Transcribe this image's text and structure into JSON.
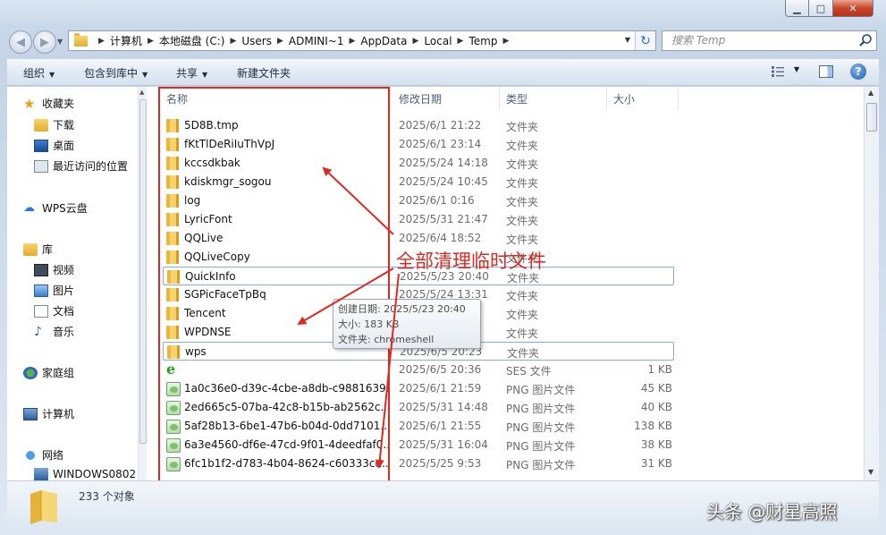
{
  "window": {
    "minimize_glyph": "▁",
    "maximize_glyph": "□",
    "close_glyph": "✕"
  },
  "nav": {
    "back_glyph": "◀",
    "forward_glyph": "▶"
  },
  "address": {
    "crumbs": [
      "计算机",
      "本地磁盘 (C:)",
      "Users",
      "ADMINI~1",
      "AppData",
      "Local",
      "Temp"
    ]
  },
  "search": {
    "placeholder": "搜索 Temp"
  },
  "toolbar": {
    "organize": "组织",
    "include_library": "包含到库中",
    "share": "共享",
    "new_folder": "新建文件夹"
  },
  "sidebar": {
    "favorites": "收藏夹",
    "downloads": "下载",
    "desktop": "桌面",
    "recent": "最近访问的位置",
    "wps_cloud": "WPS云盘",
    "libraries": "库",
    "videos": "视频",
    "pictures": "图片",
    "documents": "文档",
    "music": "音乐",
    "homegroup": "家庭组",
    "computer": "计算机",
    "network": "网络",
    "network_pc": "WINDOWS0802"
  },
  "columns": {
    "name": "名称",
    "date": "修改日期",
    "type": "类型",
    "size": "大小"
  },
  "files": [
    {
      "name": "5D8B.tmp",
      "date": "2025/6/1 21:22",
      "type": "文件夹",
      "size": "",
      "icon": "folder"
    },
    {
      "name": "fKtTlDeRiIuThVpJ",
      "date": "2025/6/1 23:14",
      "type": "文件夹",
      "size": "",
      "icon": "folder"
    },
    {
      "name": "kccsdkbak",
      "date": "2025/5/24 14:18",
      "type": "文件夹",
      "size": "",
      "icon": "folder"
    },
    {
      "name": "kdiskmgr_sogou",
      "date": "2025/5/24 10:45",
      "type": "文件夹",
      "size": "",
      "icon": "folder"
    },
    {
      "name": "log",
      "date": "2025/6/1 0:16",
      "type": "文件夹",
      "size": "",
      "icon": "folder"
    },
    {
      "name": "LyricFont",
      "date": "2025/5/31 21:47",
      "type": "文件夹",
      "size": "",
      "icon": "folder"
    },
    {
      "name": "QQLive",
      "date": "2025/6/4 18:52",
      "type": "文件夹",
      "size": "",
      "icon": "folder"
    },
    {
      "name": "QQLiveCopy",
      "date": "",
      "type": "文件夹",
      "size": "",
      "icon": "folder"
    },
    {
      "name": "QuickInfo",
      "date": "2025/5/23 20:40",
      "type": "文件夹",
      "size": "",
      "icon": "folder"
    },
    {
      "name": "SGPicFaceTpBq",
      "date": "2025/5/24 13:31",
      "type": "文件夹",
      "size": "",
      "icon": "folder"
    },
    {
      "name": "Tencent",
      "date": "",
      "type": "文件夹",
      "size": "",
      "icon": "folder"
    },
    {
      "name": "WPDNSE",
      "date": "",
      "type": "文件夹",
      "size": "",
      "icon": "folder"
    },
    {
      "name": "wps",
      "date": "2025/6/5 20:23",
      "type": "文件夹",
      "size": "",
      "icon": "folder"
    },
    {
      "name": "",
      "date": "2025/6/5 20:36",
      "type": "SES 文件",
      "size": "1 KB",
      "icon": "ie"
    },
    {
      "name": "1a0c36e0-d39c-4cbe-a8db-c9881639...",
      "date": "2025/6/1 21:59",
      "type": "PNG 图片文件",
      "size": "45 KB",
      "icon": "png"
    },
    {
      "name": "2ed665c5-07ba-42c8-b15b-ab2562c...",
      "date": "2025/5/31 14:48",
      "type": "PNG 图片文件",
      "size": "40 KB",
      "icon": "png"
    },
    {
      "name": "5af28b13-6be1-47b6-b04d-0dd7101...",
      "date": "2025/6/1 21:55",
      "type": "PNG 图片文件",
      "size": "138 KB",
      "icon": "png"
    },
    {
      "name": "6a3e4560-df6e-47cd-9f01-4deedfaf0...",
      "date": "2025/5/31 16:04",
      "type": "PNG 图片文件",
      "size": "38 KB",
      "icon": "png"
    },
    {
      "name": "6fc1b1f2-d783-4b04-8624-c60333cd...",
      "date": "2025/5/25 9:53",
      "type": "PNG 图片文件",
      "size": "31 KB",
      "icon": "png"
    }
  ],
  "tooltip": {
    "created": "创建日期: 2025/5/23 20:40",
    "size": "大小: 183 KB",
    "folders": "文件夹: chromeshell"
  },
  "annotation": "全部清理临时文件",
  "status": {
    "count": "233 个对象"
  },
  "watermark": "头条 @财星高照",
  "colors": {
    "highlight": "#e0281f",
    "selection_border": "#84acdd"
  }
}
